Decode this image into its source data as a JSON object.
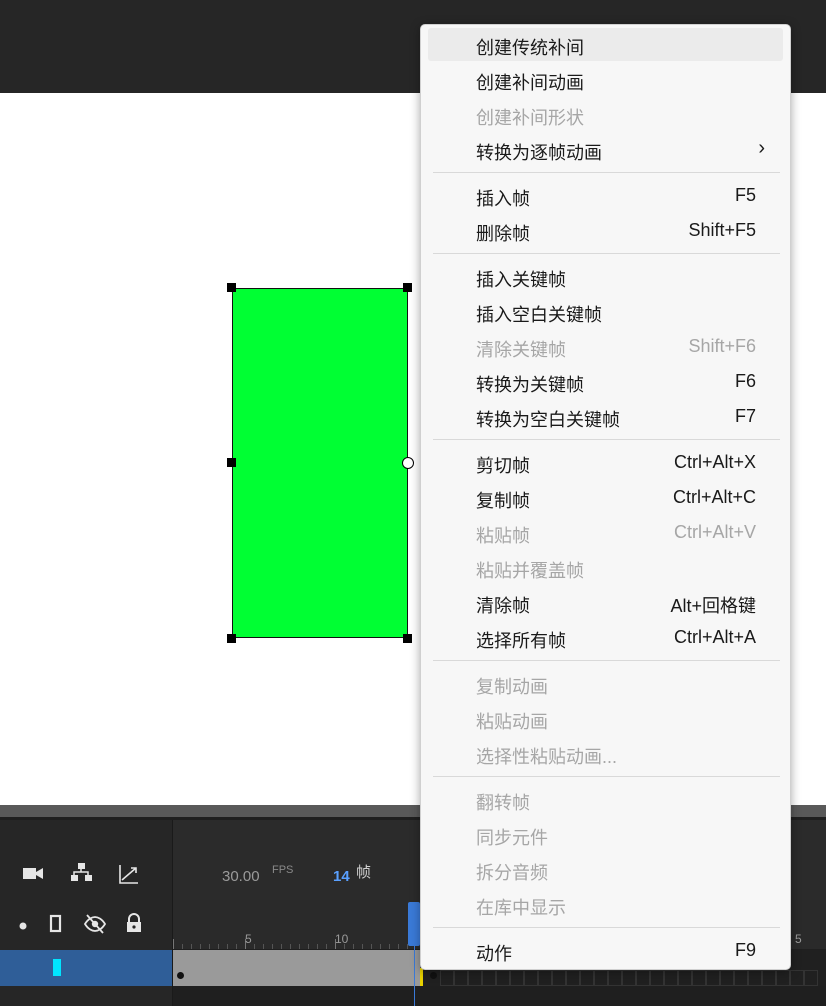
{
  "timeline": {
    "fps_value": "30.00",
    "fps_unit": "FPS",
    "current_frame": "14",
    "frame_unit": "帧",
    "ruler_labels": [
      "5",
      "10",
      "5"
    ]
  },
  "context_menu": {
    "items": [
      {
        "label": "创建传统补间",
        "shortcut": "",
        "disabled": false,
        "highlighted": true,
        "submenu": false
      },
      {
        "label": "创建补间动画",
        "shortcut": "",
        "disabled": false,
        "highlighted": false,
        "submenu": false
      },
      {
        "label": "创建补间形状",
        "shortcut": "",
        "disabled": true,
        "highlighted": false,
        "submenu": false
      },
      {
        "label": "转换为逐帧动画",
        "shortcut": "",
        "disabled": false,
        "highlighted": false,
        "submenu": true,
        "arrow": "›"
      },
      {
        "label": "插入帧",
        "shortcut": "F5",
        "disabled": false
      },
      {
        "label": "删除帧",
        "shortcut": "Shift+F5",
        "disabled": false
      },
      {
        "label": "插入关键帧",
        "shortcut": "",
        "disabled": false
      },
      {
        "label": "插入空白关键帧",
        "shortcut": "",
        "disabled": false
      },
      {
        "label": "清除关键帧",
        "shortcut": "Shift+F6",
        "disabled": true
      },
      {
        "label": "转换为关键帧",
        "shortcut": "F6",
        "disabled": false
      },
      {
        "label": "转换为空白关键帧",
        "shortcut": "F7",
        "disabled": false
      },
      {
        "label": "剪切帧",
        "shortcut": "Ctrl+Alt+X",
        "disabled": false
      },
      {
        "label": "复制帧",
        "shortcut": "Ctrl+Alt+C",
        "disabled": false
      },
      {
        "label": "粘贴帧",
        "shortcut": "Ctrl+Alt+V",
        "disabled": true
      },
      {
        "label": "粘贴并覆盖帧",
        "shortcut": "",
        "disabled": true
      },
      {
        "label": "清除帧",
        "shortcut": "Alt+回格键",
        "disabled": false
      },
      {
        "label": "选择所有帧",
        "shortcut": "Ctrl+Alt+A",
        "disabled": false
      },
      {
        "label": "复制动画",
        "shortcut": "",
        "disabled": true
      },
      {
        "label": "粘贴动画",
        "shortcut": "",
        "disabled": true
      },
      {
        "label": "选择性粘贴动画...",
        "shortcut": "",
        "disabled": true
      },
      {
        "label": "翻转帧",
        "shortcut": "",
        "disabled": true
      },
      {
        "label": "同步元件",
        "shortcut": "",
        "disabled": true
      },
      {
        "label": "拆分音频",
        "shortcut": "",
        "disabled": true
      },
      {
        "label": "在库中显示",
        "shortcut": "",
        "disabled": true
      },
      {
        "label": "动作",
        "shortcut": "F9",
        "disabled": false
      }
    ]
  },
  "colors": {
    "shape_fill": "#00ff33",
    "playhead": "#3a7ad8",
    "layer_selected": "#2f5e98"
  },
  "icons": {
    "toolbar": [
      "camera-icon",
      "hierarchy-icon",
      "graph-icon"
    ],
    "layer_controls": [
      "dot-icon",
      "outline-icon",
      "hide-icon",
      "lock-icon"
    ]
  }
}
